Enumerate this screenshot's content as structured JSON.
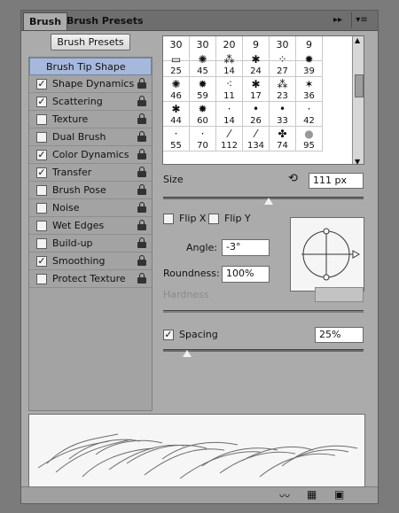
{
  "tabs": [
    {
      "label": "Brush"
    },
    {
      "label": "Brush Presets"
    }
  ],
  "panel_menu": {
    "collapse_icon": "double-arrow-right-icon",
    "menu_icon": "panel-menu-icon"
  },
  "brush_presets_button": "Brush Presets",
  "sections": [
    {
      "label": "Brush Tip Shape",
      "checked": null
    },
    {
      "label": "Shape Dynamics",
      "checked": true
    },
    {
      "label": "Scattering",
      "checked": true
    },
    {
      "label": "Texture",
      "checked": false
    },
    {
      "label": "Dual Brush",
      "checked": false
    },
    {
      "label": "Color Dynamics",
      "checked": true
    },
    {
      "label": "Transfer",
      "checked": true
    },
    {
      "label": "Brush Pose",
      "checked": false
    },
    {
      "label": "Noise",
      "checked": false
    },
    {
      "label": "Wet Edges",
      "checked": false
    },
    {
      "label": "Build-up",
      "checked": false
    },
    {
      "label": "Smoothing",
      "checked": true
    },
    {
      "label": "Protect Texture",
      "checked": false
    }
  ],
  "check_mark": "✓",
  "presets": [
    [
      "30",
      "30",
      "20",
      "9",
      "30",
      "9"
    ],
    [
      "25",
      "45",
      "14",
      "24",
      "27",
      "39"
    ],
    [
      "46",
      "59",
      "11",
      "17",
      "23",
      "36"
    ],
    [
      "44",
      "60",
      "14",
      "26",
      "33",
      "42"
    ],
    [
      "55",
      "70",
      "112",
      "134",
      "74",
      "95"
    ]
  ],
  "size": {
    "label": "Size",
    "value": "111 px",
    "reset_icon": "reset-arrow-icon"
  },
  "flip_x": {
    "label": "Flip X",
    "checked": false
  },
  "flip_y": {
    "label": "Flip Y",
    "checked": false
  },
  "angle": {
    "label": "Angle:",
    "value": "-3°"
  },
  "roundness": {
    "label": "Roundness:",
    "value": "100%"
  },
  "hardness": {
    "label": "Hardness",
    "value": ""
  },
  "spacing": {
    "label": "Spacing",
    "checked": true,
    "value": "25%"
  },
  "status_icons": [
    "toggle-brush-preview-icon",
    "brush-grid-icon",
    "new-preset-icon"
  ]
}
